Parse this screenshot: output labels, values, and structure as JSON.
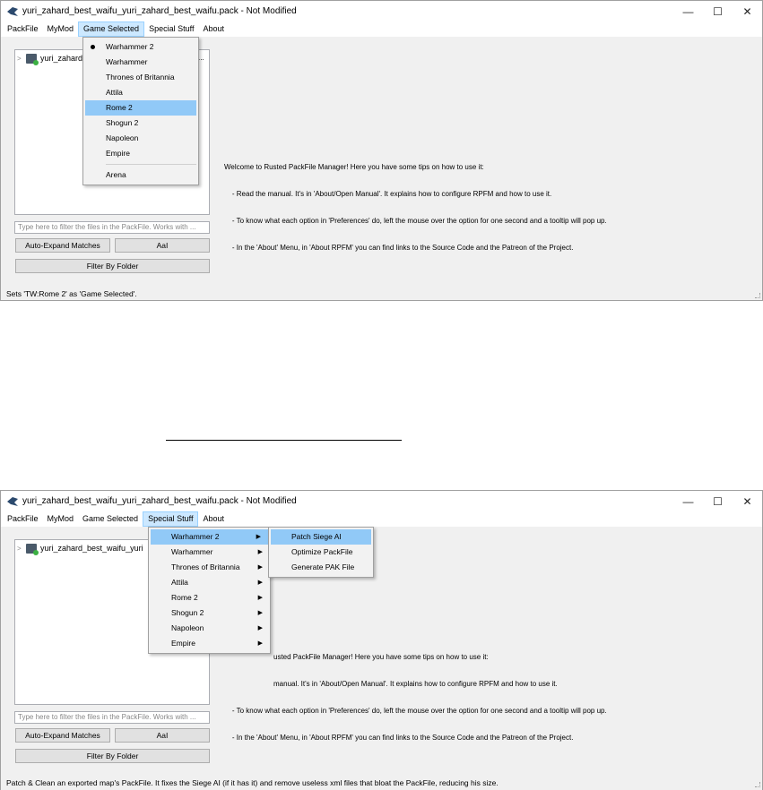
{
  "title": "yuri_zahard_best_waifu_yuri_zahard_best_waifu.pack - Not Modified",
  "window_buttons": {
    "minimize": "—",
    "maximize": "☐",
    "close": "✕"
  },
  "menubar": [
    "PackFile",
    "MyMod",
    "Game Selected",
    "Special Stuff",
    "About"
  ],
  "top": {
    "tree_label": "yuri_zahard",
    "tree_label_tail": "...",
    "game_menu": {
      "items": [
        "Warhammer 2",
        "Warhammer",
        "Thrones of Britannia",
        "Attila",
        "Rome 2",
        "Shogun 2",
        "Napoleon",
        "Empire"
      ],
      "extra": "Arena",
      "checked": "Warhammer 2",
      "highlighted": "Rome 2"
    },
    "status": "Sets 'TW:Rome 2' as 'Game Selected'."
  },
  "bottom": {
    "tree_label": "yuri_zahard_best_waifu_yuri",
    "special_menu": {
      "items": [
        "Warhammer 2",
        "Warhammer",
        "Thrones of Britannia",
        "Attila",
        "Rome 2",
        "Shogun 2",
        "Napoleon",
        "Empire"
      ],
      "submenu": [
        "Patch Siege AI",
        "Optimize PackFile",
        "Generate PAK File"
      ],
      "highlighted_submenu": "Patch Siege AI"
    },
    "status": "Patch & Clean an exported map's PackFile. It fixes the Siege AI (if it has it) and remove useless xml files that bloat the PackFile, reducing his size."
  },
  "sidebar": {
    "filter_placeholder": "Type here to filter the files in the PackFile. Works with ...",
    "auto_expand": "Auto-Expand Matches",
    "case_button": "AaI",
    "filter_by_folder": "Filter By Folder"
  },
  "welcome": {
    "line1": "Welcome to Rusted PackFile Manager! Here you have some tips on how to use it:",
    "line2": "    - Read the manual. It's in 'About/Open Manual'. It explains how to configure RPFM and how to use it.",
    "line3": "    - To know what each option in 'Preferences' do, left the mouse over the option for one second and a tooltip will pop up.",
    "line4": "    - In the 'About' Menu, in 'About RPFM' you can find links to the Source Code and the Patreon of the Project.",
    "b_line1": "usted PackFile Manager! Here you have some tips on how to use it:",
    "b_line2": "manual. It's in 'About/Open Manual'. It explains how to configure RPFM and how to use it.",
    "b_line3": "    - To know what each option in 'Preferences' do, left the mouse over the option for one second and a tooltip will pop up.",
    "b_line4": "    - In the 'About' Menu, in 'About RPFM' you can find links to the Source Code and the Patreon of the Project."
  }
}
